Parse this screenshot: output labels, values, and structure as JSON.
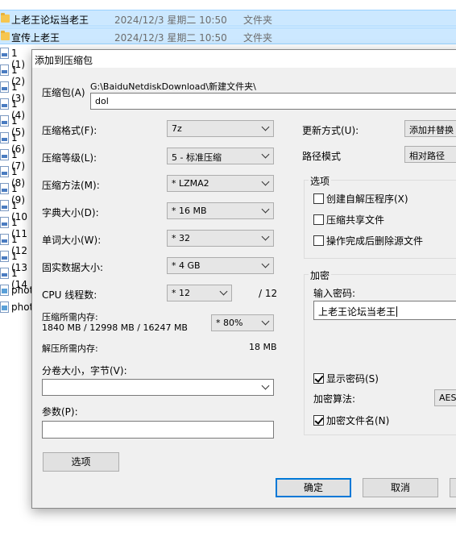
{
  "explorer": {
    "rows": [
      {
        "name": "上老王论坛当老王",
        "date": "2024/12/3 星期二 10:50",
        "type": "文件夹"
      },
      {
        "name": "宣传上老王",
        "date": "2024/12/3 星期二 10:50",
        "type": "文件夹"
      }
    ],
    "side_items": [
      "1 (1)",
      "1 (2)",
      "1 (3)",
      "1 (4)",
      "1 (5)",
      "1 (6)",
      "1 (7)",
      "1 (8)",
      "1 (9)",
      "1 (10",
      "1 (11",
      "1 (12",
      "1 (13",
      "1 (14",
      "phot",
      "phot"
    ]
  },
  "dialog": {
    "title": "添加到压缩包",
    "archive_label": "压缩包(A)",
    "archive_path": "G:\\BaiduNetdiskDownload\\新建文件夹\\",
    "archive_name": "dol",
    "format_label": "压缩格式(F):",
    "format_value": "7z",
    "level_label": "压缩等级(L):",
    "level_value": "5 - 标准压缩",
    "method_label": "压缩方法(M):",
    "method_value": "* LZMA2",
    "dict_label": "字典大小(D):",
    "dict_value": "* 16 MB",
    "word_label": "单词大小(W):",
    "word_value": "* 32",
    "solid_label": "固实数据大小:",
    "solid_value": "* 4 GB",
    "threads_label": "CPU 线程数:",
    "threads_value": "* 12",
    "threads_total": "/ 12",
    "mem_compress_label": "压缩所需内存:",
    "mem_compress_value": "1840 MB / 12998 MB / 16247 MB",
    "mem_percent": "* 80%",
    "mem_decompress_label": "解压所需内存:",
    "mem_decompress_value": "18 MB",
    "volume_label": "分卷大小，字节(V):",
    "params_label": "参数(P):",
    "options_button": "选项",
    "update_label": "更新方式(U):",
    "update_value": "添加并替换",
    "path_mode_label": "路径模式",
    "path_mode_value": "相对路径",
    "options_group": "选项",
    "opt_sfx": "创建自解压程序(X)",
    "opt_shared": "压缩共享文件",
    "opt_delete": "操作完成后删除源文件",
    "encrypt_group": "加密",
    "password_label": "输入密码:",
    "password_value": "上老王论坛当老王",
    "show_password": "显示密码(S)",
    "enc_method_label": "加密算法:",
    "enc_method_value": "AES-",
    "encrypt_names": "加密文件名(N)",
    "ok_button": "确定",
    "cancel_button": "取消"
  }
}
